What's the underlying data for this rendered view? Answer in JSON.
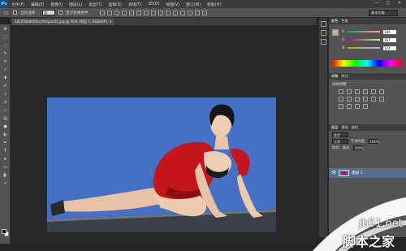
{
  "app": {
    "logo": "Ps"
  },
  "menubar": {
    "items": [
      "文件(F)",
      "编辑(E)",
      "图像(I)",
      "图层(L)",
      "类型(Y)",
      "选择(S)",
      "滤镜(T)",
      "3D(D)",
      "视图(V)",
      "窗口(W)",
      "帮助(H)"
    ]
  },
  "window_controls": {
    "minimize": "—",
    "maximize": "□",
    "close": "✕"
  },
  "options": {
    "auto_select_label": "自动选择：",
    "auto_select_value": "组",
    "transform_label": "显示变换控件",
    "workspace": "基本功能"
  },
  "document": {
    "tab_title": "181656tdh6fbcz9mpuz45.jpg @ 50% (图层 1, RGB/8#)",
    "close": "×"
  },
  "panels": {
    "color_tabs": [
      "颜色",
      "色板"
    ],
    "sliders": [
      {
        "label": "R",
        "value": "186"
      },
      {
        "label": "G",
        "value": "167"
      },
      {
        "label": "B",
        "value": "124"
      }
    ],
    "adjust_tabs": [
      "调整",
      "样式"
    ],
    "adjust_title": "添加调整",
    "layers_tabs": [
      "图层",
      "通道",
      "路径"
    ],
    "kind_label": "类型",
    "blend_mode": "正常",
    "opacity_label": "不透明度:",
    "opacity_value": "100%",
    "lock_label": "锁定:",
    "fill_label": "填充:",
    "fill_value": "100%",
    "layer_name": "图层 1",
    "layer_visibility": "👁"
  },
  "watermark": {
    "site": "jb51.net",
    "cn": "脚本之家"
  },
  "colors": {
    "canvas_bg": "#4570c4",
    "foreground": "#c9b48a",
    "selected_layer": "#596e8c"
  }
}
